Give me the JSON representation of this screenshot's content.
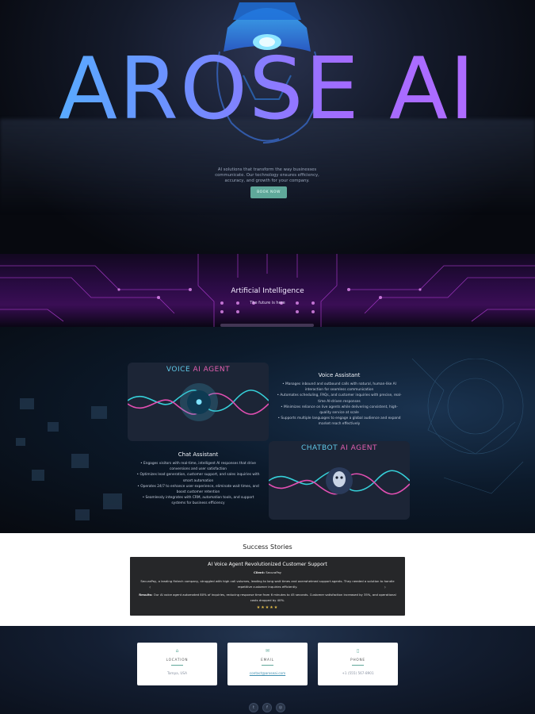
{
  "hero": {
    "title": "AROSE AI",
    "subtitle": "AI solutions that transform the way businesses communicate. Our technology ensures efficiency, accuracy, and growth for your company.",
    "cta_label": "BOOK NOW"
  },
  "ai_band": {
    "title": "Artificial Intelligence",
    "tagline": "The future is here"
  },
  "services": {
    "voice_card": {
      "title_main": "VOICE ",
      "title_ai": "AI ",
      "title_agent": "AGENT",
      "icon": "microphone-icon"
    },
    "chatbot_card": {
      "title_main": "CHATBOT ",
      "title_ai": "AI ",
      "title_agent": "AGENT",
      "icon": "robot-icon"
    },
    "voice_assistant": {
      "heading": "Voice Assistant",
      "items": [
        "Manages inbound and outbound calls with natural, human-like AI interaction for seamless communication",
        "Automates scheduling, FAQs, and customer inquiries with precise, real-time AI-driven responses",
        "Minimizes reliance on live agents while delivering consistent, high-quality service at scale",
        "Supports multiple languages to engage a global audience and expand market reach effectively"
      ]
    },
    "chat_assistant": {
      "heading": "Chat Assistant",
      "items": [
        "Engages visitors with real-time, intelligent AI responses that drive conversions and user satisfaction",
        "Optimizes lead generation, customer support, and sales inquiries with smart automation",
        "Operates 24/7 to enhance user experience, eliminate wait times, and boost customer retention",
        "Seamlessly integrates with CRM, automation tools, and support systems for business efficiency"
      ]
    }
  },
  "success": {
    "heading": "Success Stories",
    "story_title": "AI Voice Agent Revolutionized Customer Support",
    "client_label": "Client:",
    "client_name": "SecuraPay",
    "body": "SecuraPay, a leading fintech company, struggled with high call volumes, leading to long wait times and overwhelmed support agents. They needed a solution to handle repetitive customer inquiries efficiently.",
    "results_label": "Results:",
    "results": "Our AI voice agent automated 80% of inquiries, reducing response time from 6 minutes to 45 seconds. Customer satisfaction increased by 35%, and operational costs dropped by 40%.",
    "stars": "★★★★★",
    "prev": "‹",
    "next": "›"
  },
  "contact": {
    "location": {
      "icon": "map-pin-icon",
      "label": "LOCATION",
      "value": "Tampa, USA"
    },
    "email": {
      "icon": "envelope-icon",
      "label": "EMAIL",
      "value": "contact@aroseai.com"
    },
    "phone": {
      "icon": "phone-icon",
      "label": "PHONE",
      "value": "+1 (555) 567-8901"
    },
    "social": [
      {
        "name": "twitter-icon",
        "glyph": "t"
      },
      {
        "name": "facebook-icon",
        "glyph": "f"
      },
      {
        "name": "instagram-icon",
        "glyph": "◎"
      }
    ]
  },
  "colors": {
    "accent": "#5fa89a",
    "title_blue": "#4fb8ff",
    "title_purple": "#a46bff",
    "card_cyan": "#5fc7e6",
    "card_pink": "#e35fb1",
    "star": "#e8c04a"
  }
}
